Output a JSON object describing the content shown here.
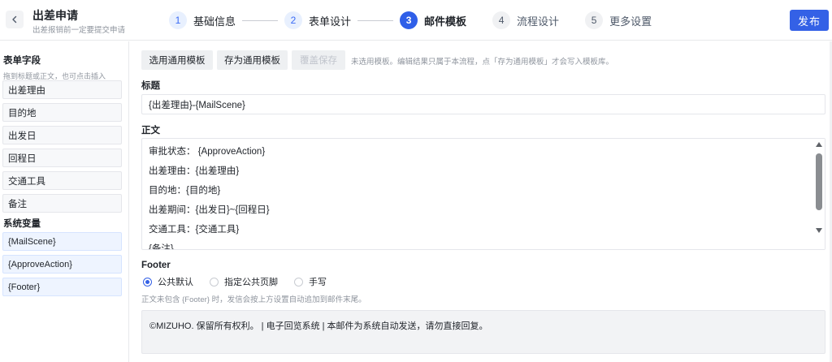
{
  "header": {
    "title": "出差申请",
    "subtitle": "出差报销前一定要提交申请",
    "publish_label": "发布"
  },
  "steps": [
    {
      "number": "1",
      "label": "基础信息",
      "state": "done"
    },
    {
      "number": "2",
      "label": "表单设计",
      "state": "done"
    },
    {
      "number": "3",
      "label": "邮件模板",
      "state": "active"
    },
    {
      "number": "4",
      "label": "流程设计",
      "state": "future"
    },
    {
      "number": "5",
      "label": "更多设置",
      "state": "future"
    }
  ],
  "sidebar": {
    "form_fields_heading": "表单字段",
    "form_fields_hint": "拖到标题或正文，也可点击插入",
    "form_fields": [
      "出差理由",
      "目的地",
      "出发日",
      "回程日",
      "交通工具",
      "备注"
    ],
    "system_vars_heading": "系统变量",
    "system_vars": [
      "{MailScene}",
      "{ApproveAction}",
      "{Footer}"
    ]
  },
  "toolbar": {
    "select_template": "选用通用模板",
    "save_template": "存为通用模板",
    "overwrite_save": "覆盖保存",
    "note": "未选用模板。编辑结果只属于本流程，点「存为通用模板」才会写入模板库。"
  },
  "subject": {
    "label": "标题",
    "value": "{出差理由}-{MailScene}"
  },
  "body": {
    "label": "正文",
    "lines": [
      "审批状态： {ApproveAction}",
      "出差理由：{出差理由}",
      "目的地：{目的地}",
      "出差期间：{出发日}~{回程日}",
      "交通工具：{交通工具}",
      "{备注}"
    ]
  },
  "footer": {
    "label": "Footer",
    "options": [
      {
        "label": "公共默认",
        "checked": true
      },
      {
        "label": "指定公共页脚",
        "checked": false
      },
      {
        "label": "手写",
        "checked": false
      }
    ],
    "note": "正文未包含 {Footer} 时，发信会按上方设置自动追加到邮件末尾。",
    "preview_text": "©MIZUHO. 保留所有权利。 | 电子回览系统 | 本邮件为系统自动发送，请勿直接回复。"
  },
  "colors": {
    "accent": "#3461e6",
    "active_step": "#2f5fe8",
    "var_bg": "#eef4ff"
  }
}
